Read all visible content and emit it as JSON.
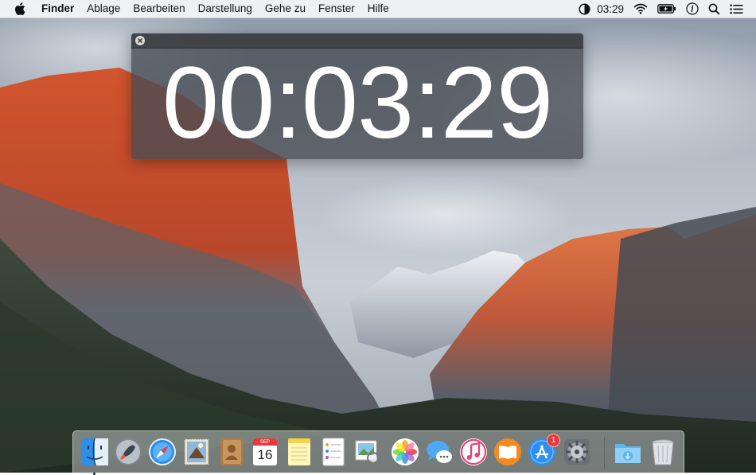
{
  "menubar": {
    "app_name": "Finder",
    "menus": [
      "Ablage",
      "Bearbeiten",
      "Darstellung",
      "Gehe zu",
      "Fenster",
      "Hilfe"
    ],
    "clock": "03:29",
    "status_icons": [
      "timer-icon",
      "wifi-icon",
      "battery-icon",
      "info-icon",
      "spotlight-search-icon",
      "notification-center-icon"
    ]
  },
  "timer_window": {
    "time": "00:03:29"
  },
  "dock": {
    "apps": [
      {
        "name": "finder",
        "running": true
      },
      {
        "name": "launchpad"
      },
      {
        "name": "safari"
      },
      {
        "name": "mail"
      },
      {
        "name": "contacts"
      },
      {
        "name": "calendar",
        "month": "SEP",
        "day": "16"
      },
      {
        "name": "notes"
      },
      {
        "name": "reminders"
      },
      {
        "name": "preview"
      },
      {
        "name": "photos"
      },
      {
        "name": "messages"
      },
      {
        "name": "itunes"
      },
      {
        "name": "ibooks"
      },
      {
        "name": "app-store",
        "badge": "1"
      },
      {
        "name": "system-preferences"
      },
      {
        "name": "downloads-folder"
      },
      {
        "name": "trash"
      }
    ]
  },
  "colors": {
    "menubar_bg": "#f6f6f6",
    "timer_bg": "#464a52",
    "badge": "#e8383d"
  }
}
